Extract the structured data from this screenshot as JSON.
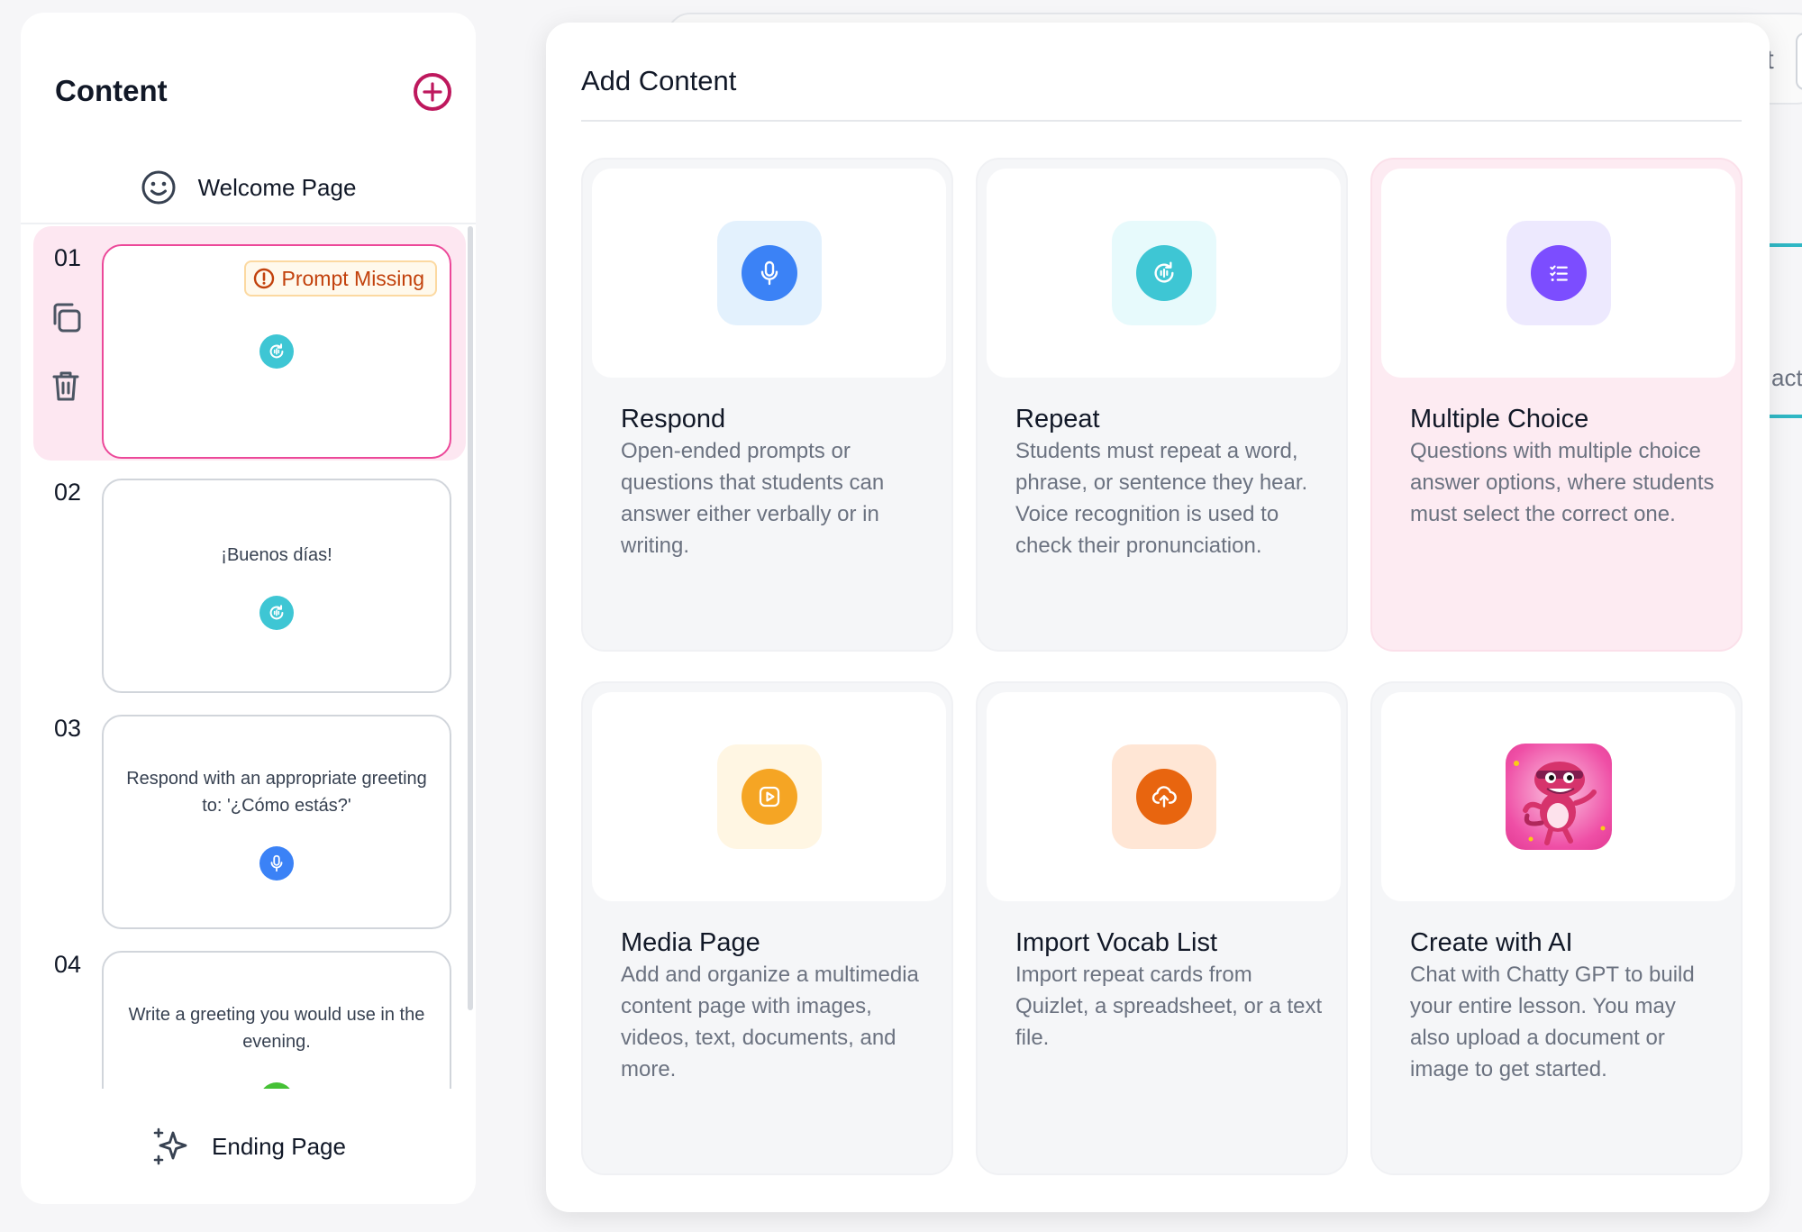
{
  "sidebar": {
    "title": "Content",
    "welcome_label": "Welcome Page",
    "ending_label": "Ending Page",
    "slides": [
      {
        "number": "01",
        "text": "",
        "badge": "Prompt Missing",
        "icon": "repeat-icon"
      },
      {
        "number": "02",
        "text": "¡Buenos días!",
        "icon": "repeat-icon"
      },
      {
        "number": "03",
        "text": "Respond with an appropriate greeting to: '¿Cómo estás?'",
        "icon": "respond-icon"
      },
      {
        "number": "04",
        "text": "Write a greeting you would use in the evening.",
        "icon": "written-icon"
      }
    ]
  },
  "background": {
    "peek_top": "ıt",
    "peek_mid": "acte"
  },
  "panel": {
    "title": "Add Content",
    "tiles": [
      {
        "title": "Respond",
        "description": "Open-ended prompts or questions that students can answer either verbally or in writing.",
        "icon": "microphone-icon",
        "color": "#3b82f6",
        "bg": "#e3f1fd"
      },
      {
        "title": "Repeat",
        "description": "Students must repeat a word, phrase, or sentence they hear. Voice recognition is used to check their pronunciation.",
        "icon": "repeat-audio-icon",
        "color": "#3ec6d4",
        "bg": "#e7fafc"
      },
      {
        "title": "Multiple Choice",
        "description": "Questions with multiple choice answer options, where students must select the correct one.",
        "icon": "list-icon",
        "color": "#7c4dff",
        "bg": "#ede9fe"
      },
      {
        "title": "Media Page",
        "description": "Add and organize a multimedia content page with images, videos, text, documents, and more.",
        "icon": "play-icon",
        "color": "#f5a524",
        "bg": "#fff6e3"
      },
      {
        "title": "Import Vocab List",
        "description": "Import repeat cards from Quizlet, a spreadsheet, or a text file.",
        "icon": "upload-cloud-icon",
        "color": "#e8650f",
        "bg": "#ffe6d5"
      },
      {
        "title": "Create with AI",
        "description": "Chat with Chatty GPT to build your entire lesson. You may also upload a document or image to get started.",
        "icon": "mascot-icon",
        "color": "#ec4899",
        "bg": "#fde7f1"
      }
    ]
  }
}
